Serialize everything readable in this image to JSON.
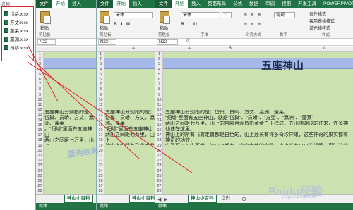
{
  "explorer": {
    "header": "名称",
    "files": [
      "岱岳.xlsx",
      "方丈.xlsx",
      "蓬莱.xlsx",
      "瀛洲.xlsx",
      "员峤.xlsx"
    ]
  },
  "windows": [
    {
      "tabs": [
        "文件",
        "开始",
        "插入"
      ],
      "active_tab": "开始",
      "paste_label": "粘贴",
      "clipboard_label": "剪贴板",
      "name_box": "N22",
      "sheet_tab": "神山小百科",
      "status": "就绪",
      "body_text": "五座神山分别指的是：岱舆、员峤、方丈、瀛洲、蓬莱\n。“归墟”里面有五座神山\n两山之间距七万里，山上\n神山上的所有飞禽走兽都\n吃了可以长生不老。神山\n将自由地飞翔，往返于五"
    },
    {
      "tabs": [
        "文件",
        "开始",
        "插入"
      ],
      "active_tab": "开始",
      "paste_label": "粘贴",
      "clipboard_label": "剪贴板",
      "font_name": "宋体",
      "name_box": "N22",
      "col_a": "A",
      "sheet_tab": "神山小百科",
      "status": "就绪",
      "body_text": "五座神山分别指的是：岱舆、员峤、方丈、瀛洲、蓬莱\n“归墟”里面有五座神山\n两山之间距七万里，山上\n神山上的所有飞禽走兽都\n吃了可以长生不老。神山\n将自由地飞翔，往返于五"
    },
    {
      "tabs": [
        "文件",
        "开始",
        "插入",
        "页面布局",
        "公式",
        "数据",
        "审阅",
        "视图",
        "开发工具",
        "POWERPIVOT"
      ],
      "active_tab": "开始",
      "paste_label": "粘贴",
      "clipboard_label": "剪贴板",
      "font_label": "字体",
      "font_name": "宋体",
      "font_size": "11",
      "align_label": "对齐方式",
      "number_label": "数字",
      "cond_format_label": "条件格式",
      "table_format_label": "套用表格格式",
      "cell_style_label": "单元格样式",
      "style_label": "样式",
      "number_format": "常规",
      "name_box": "N22",
      "col_a": "A",
      "col_b": "B",
      "col_c": "C",
      "big_title": "五座神山",
      "sheet_tabs": [
        "神山小百科",
        "岱舆"
      ],
      "status": "就绪",
      "body_text": "五座神山分别指的是：岱舆、员峤、方丈、瀛洲、蓬莱。\n“归墟”里面有五座神山，就是“岱舆”、“员峤”、“方壶”、“瀛洲”、“蓬莱”\n两山之间距七万里，山上的宫殿台观皆由黄金白玉建成，五山随潮汐的往来，许多神仙住在这里。\n神山上的所有飞禽走兽都是白色的，山上还长有许多奇珍异果，这些神奇的果实都有神奇的功效，\n吃了可以长生不老。神山上都有一座座宏伟的宫殿，身上长有小小的翅膀，平时这些神仙们在天际\n将自由地飞翔，往返于五座神山之间，探望他们的亲戚朋友。神仙们在这里过着快乐的日子。"
    }
  ],
  "row_numbers": [
    "1",
    "2",
    "3",
    "4",
    "5",
    "6",
    "7",
    "8",
    "9",
    "10",
    "11",
    "12",
    "13",
    "14",
    "15",
    "16",
    "17",
    "18",
    "19",
    "20",
    "21",
    "22",
    "23",
    "24",
    "25",
    "26",
    "27",
    "28"
  ],
  "watermark": "Baidu经验",
  "watermark_sub": "jingyan.baidu.com",
  "overlay_watermark": "蓝色映射",
  "colors": {
    "excel_green": "#217346",
    "sheet_green": "#cbe2b0",
    "header_blue": "#a6b8e8",
    "annotation_red": "#e02030"
  }
}
